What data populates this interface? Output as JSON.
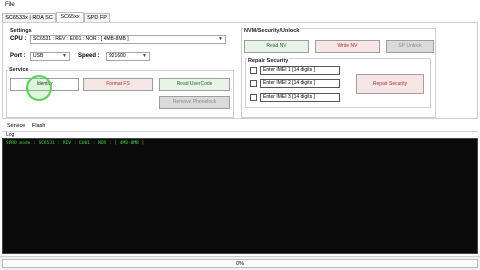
{
  "menu": {
    "file": "File"
  },
  "tabs": [
    {
      "label": "SC6533x | RDA SC"
    },
    {
      "label": "SC65xx"
    },
    {
      "label": "SPD FP"
    }
  ],
  "settings": {
    "title": "Settings",
    "cpu_label": "CPU :",
    "cpu_value": "SC6531 : REV : E001 : NOR : [ 4MB-8MB ]",
    "port_label": "Port :",
    "port_value": "USB",
    "speed_label": "Speed :",
    "speed_value": "921600"
  },
  "service": {
    "title": "Service",
    "identify": "Identify",
    "format_fs": "Format FS",
    "read_usercode": "Read UserCode",
    "remove_phonelock": "Remove Phonelock"
  },
  "nvm": {
    "title": "NVM/Security/Unlock",
    "read_nv": "Read NV",
    "write_nv": "Write NV",
    "sp_unlock": "SP Unlock"
  },
  "repair": {
    "title": "Repair Security",
    "imei1": "Enter IMEI 1 [14 digits ]",
    "imei2": "Enter IMEI 2 [14 digits ]",
    "imei3": "Enter IMEI 3 [14 digits ]",
    "repair_button": "Repair Security"
  },
  "log": {
    "tab_service": "Service",
    "tab_flash": "Flash",
    "label": "Log",
    "line1": "SPRD mode : SC6531 : REV : E001 : NOR : [ 4MB-8MB ]"
  },
  "status": {
    "progress_text": "0%",
    "progress_value": 0
  },
  "colors": {
    "console_bg": "#0b0b0b",
    "console_text": "#3cd63c",
    "highlight": "#5ad25a"
  }
}
